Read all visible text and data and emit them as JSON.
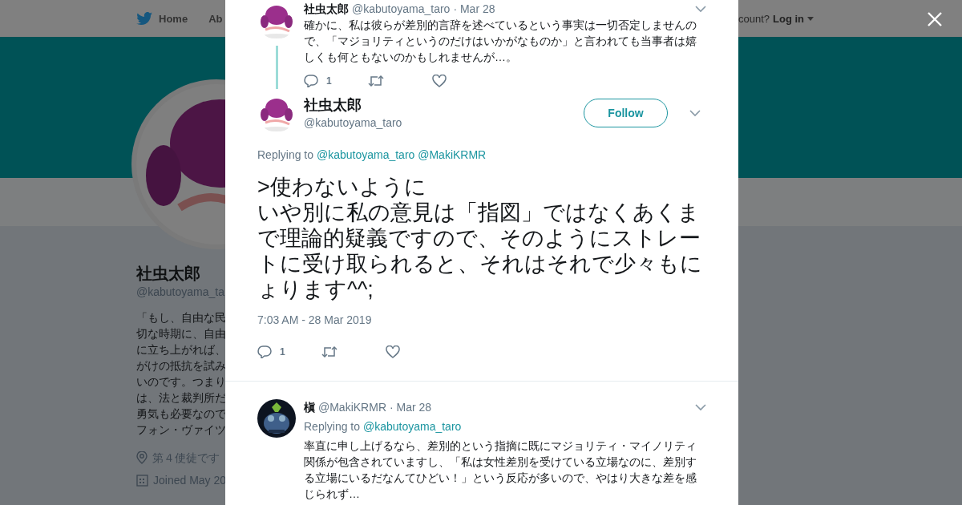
{
  "background": {
    "nav": [
      {
        "kind": "home",
        "label": "Home"
      },
      {
        "kind": "plain",
        "label": "Ab"
      }
    ],
    "login": {
      "prompt": "count?",
      "link": "Log in"
    },
    "profile": {
      "name": "社虫太郎",
      "handle": "@kabutoyama_ta",
      "bio_lines": [
        "「もし、自由な民",
        "切な時期に、自由",
        "に立ち上がれば、",
        "がけの抵抗を試み",
        "いのです。つまり",
        "は、法と裁判所だ",
        "勇気も必要なので",
        "フォン・ヴァイツ"
      ],
      "location": "第４使徒です",
      "joined": "Joined May 20"
    }
  },
  "tweets": [
    {
      "kind": "parent",
      "name": "社虫太郎",
      "handle": "@kabutoyama_taro",
      "date": "· Mar 28",
      "text": "確かに、私は彼らが差別的言辞を述べているという事実は一切否定しませんので、「マジョリティというのだけはいかがなものか」と言われても当事者は嬉しくも何ともないのかもしれませんが…。",
      "reply_count": "1"
    },
    {
      "kind": "focus",
      "name": "社虫太郎",
      "handle": "@kabutoyama_taro",
      "follow_label": "Follow",
      "replying_label": "Replying to",
      "replying_to": [
        "@kabutoyama_taro",
        "@MakiKRMR"
      ],
      "text_lines": [
        ">使わないように",
        "いや別に私の意見は「指図」ではなくあくまで理論的疑義ですので、そのようにストレートに受け取られると、それはそれで少々もにょります^^;"
      ],
      "timestamp": "7:03 AM - 28 Mar 2019",
      "reply_count": "1"
    },
    {
      "kind": "reply",
      "name": "槇",
      "handle": "@MakiKRMR",
      "date": "· Mar 28",
      "replying_label": "Replying to",
      "replying_to": [
        "@kabutoyama_taro"
      ],
      "text": "率直に申し上げるなら、差別的という指摘に既にマジョリティ・マイノリティ関係が包含されていますし、「私は女性差別を受けている立場なのに、差別する立場にいるだなんてひどい！」という反応が多いので、やはり大きな差を感じられず…"
    }
  ]
}
